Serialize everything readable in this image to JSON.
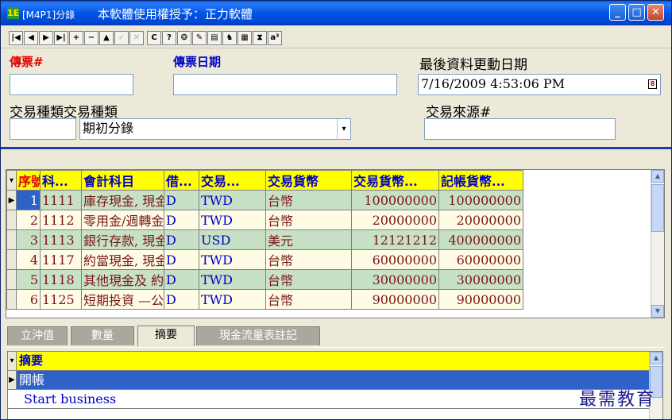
{
  "window": {
    "title_code": "[M4P1]分錄",
    "title_license": "本軟體使用權授予：正力軟體",
    "app_icon": "1E"
  },
  "toolbar": {
    "buttons": [
      {
        "name": "first-record-icon",
        "glyph": "|◀"
      },
      {
        "name": "prev-record-icon",
        "glyph": "◀"
      },
      {
        "name": "next-record-icon",
        "glyph": "▶"
      },
      {
        "name": "last-record-icon",
        "glyph": "▶|"
      },
      {
        "name": "add-record-icon",
        "glyph": "+"
      },
      {
        "name": "delete-record-icon",
        "glyph": "−"
      },
      {
        "name": "edit-record-icon",
        "glyph": "▲"
      },
      {
        "name": "post-edit-icon",
        "glyph": "✓"
      },
      {
        "name": "cancel-edit-icon",
        "glyph": "✕"
      },
      {
        "name": "refresh-icon",
        "glyph": "C"
      },
      {
        "name": "help-icon",
        "glyph": "?"
      },
      {
        "name": "about-icon",
        "glyph": "❂"
      },
      {
        "name": "pencil-icon",
        "glyph": "✎"
      },
      {
        "name": "copy-icon",
        "glyph": "▤"
      },
      {
        "name": "binoculars-icon",
        "glyph": "♞"
      },
      {
        "name": "printer-icon",
        "glyph": "▦"
      },
      {
        "name": "hourglass-icon",
        "glyph": "⧗"
      },
      {
        "name": "sort-icon",
        "glyph": "a³"
      }
    ]
  },
  "form": {
    "voucher_no_label": "傳票#",
    "voucher_no_value": "",
    "voucher_date_label": "傳票日期",
    "voucher_date_value": "",
    "last_update_label": "最後資料更動日期",
    "last_update_value": "7/16/2009 4:53:06 PM",
    "txn_type_label": "交易種類",
    "txn_type_label2": "交易種類",
    "txn_type_code": "",
    "txn_type_value": "期初分錄",
    "txn_source_label": "交易來源#",
    "txn_source_value": ""
  },
  "grid": {
    "columns": [
      "序號",
      "科...",
      "會計科目",
      "借...",
      "交易...",
      "交易貨幣",
      "交易貨幣...",
      "記帳貨幣..."
    ],
    "rows": [
      {
        "seq": "1",
        "code": "1111",
        "account": "庫存現金, 現金及約當",
        "dc": "D",
        "txn": "TWD",
        "currency": "台幣",
        "txn_amount": "100000000",
        "book_amount": "100000000"
      },
      {
        "seq": "2",
        "code": "1112",
        "account": "零用金/週轉金, 現金",
        "dc": "D",
        "txn": "TWD",
        "currency": "台幣",
        "txn_amount": "20000000",
        "book_amount": "20000000"
      },
      {
        "seq": "3",
        "code": "1113",
        "account": "銀行存款, 現金及約當",
        "dc": "D",
        "txn": "USD",
        "currency": "美元",
        "txn_amount": "12121212",
        "book_amount": "400000000"
      },
      {
        "seq": "4",
        "code": "1117",
        "account": "約當現金, 現金及約當",
        "dc": "D",
        "txn": "TWD",
        "currency": "台幣",
        "txn_amount": "60000000",
        "book_amount": "60000000"
      },
      {
        "seq": "5",
        "code": "1118",
        "account": "其他現金及 約當現金,",
        "dc": "D",
        "txn": "TWD",
        "currency": "台幣",
        "txn_amount": "30000000",
        "book_amount": "30000000"
      },
      {
        "seq": "6",
        "code": "1125",
        "account": "短期投資 —公司債,",
        "dc": "D",
        "txn": "TWD",
        "currency": "台幣",
        "txn_amount": "90000000",
        "book_amount": "90000000"
      }
    ]
  },
  "tabs": [
    {
      "label": "立沖值",
      "active": false
    },
    {
      "label": "數量",
      "active": false
    },
    {
      "label": "摘要",
      "active": true
    },
    {
      "label": "現金流量表註記",
      "active": false
    }
  ],
  "summary": {
    "header": "摘要",
    "rows": [
      "開帳",
      "Start business"
    ]
  },
  "watermark": "最需教育"
}
